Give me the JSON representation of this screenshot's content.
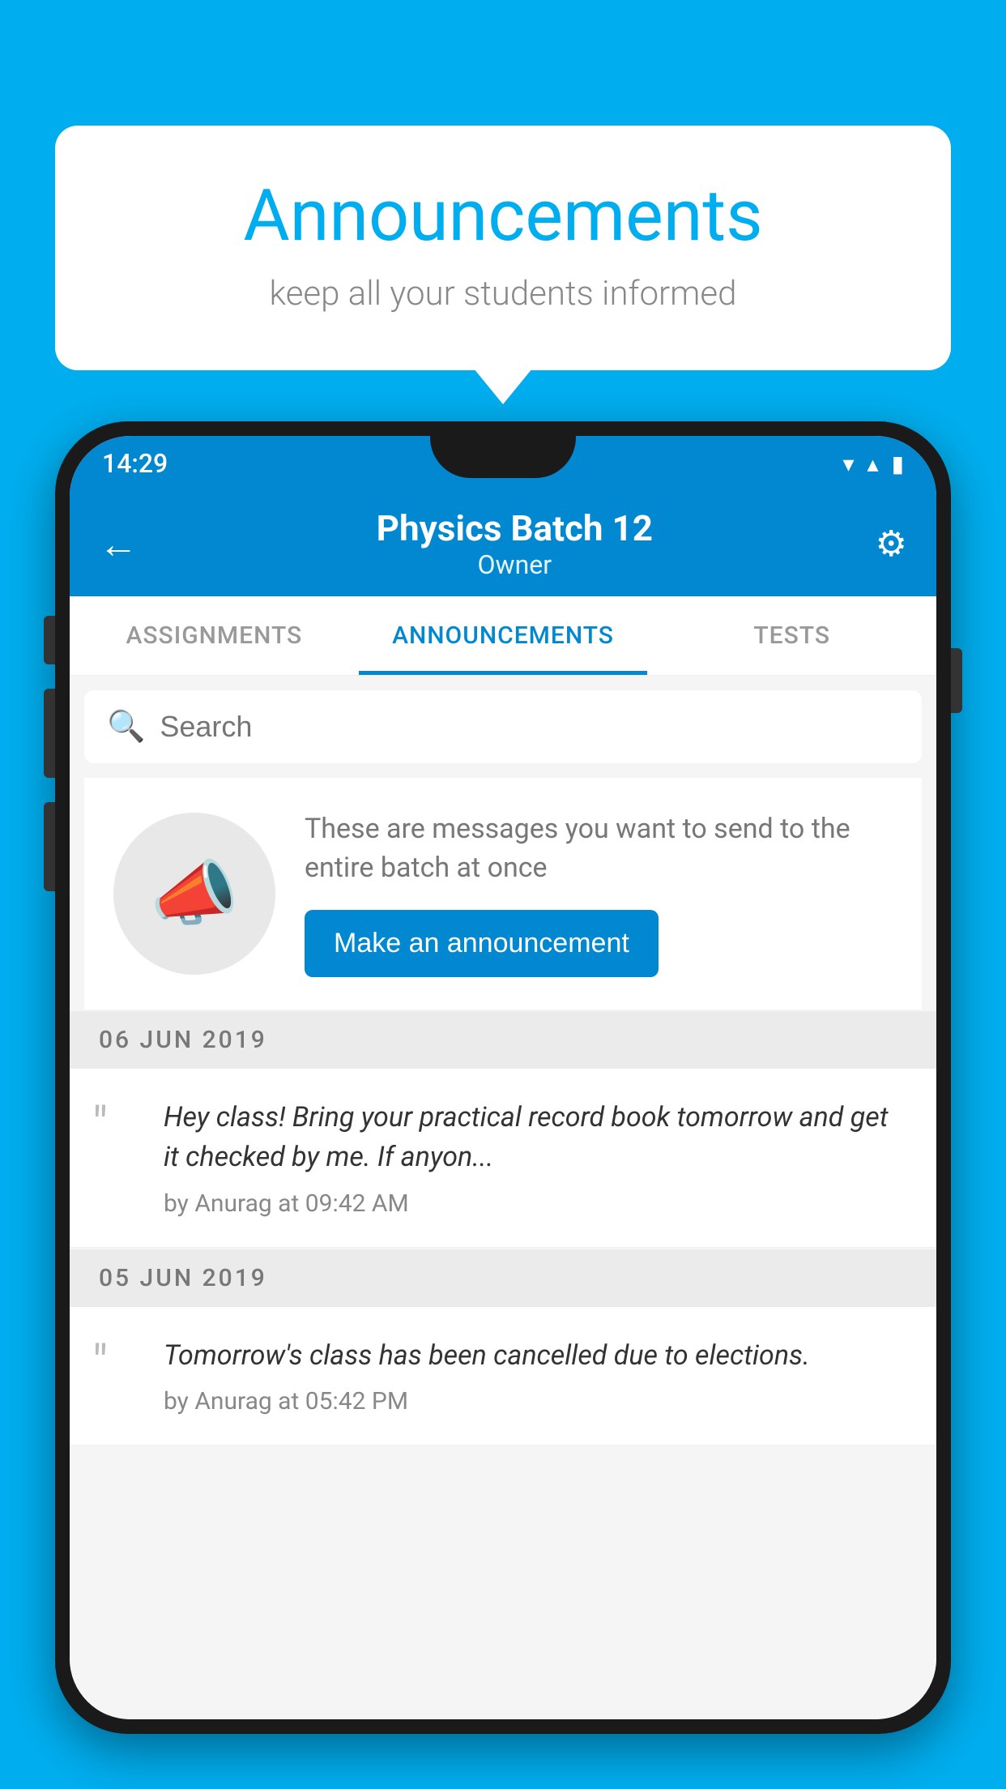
{
  "background_color": "#00AEEF",
  "speech_bubble": {
    "title": "Announcements",
    "subtitle": "keep all your students informed"
  },
  "phone": {
    "status_bar": {
      "time": "14:29",
      "wifi": "▼",
      "signal": "▲",
      "battery": "▮"
    },
    "app_bar": {
      "title": "Physics Batch 12",
      "subtitle": "Owner",
      "back_label": "←",
      "settings_label": "⚙"
    },
    "tabs": [
      {
        "label": "ASSIGNMENTS",
        "active": false
      },
      {
        "label": "ANNOUNCEMENTS",
        "active": true
      },
      {
        "label": "TESTS",
        "active": false
      }
    ],
    "search": {
      "placeholder": "Search"
    },
    "empty_state": {
      "description": "These are messages you want to send to the entire batch at once",
      "button_label": "Make an announcement"
    },
    "announcements": [
      {
        "date": "06  JUN  2019",
        "text": "Hey class! Bring your practical record book tomorrow and get it checked by me. If anyon...",
        "meta": "by Anurag at 09:42 AM"
      },
      {
        "date": "05  JUN  2019",
        "text": "Tomorrow's class has been cancelled due to elections.",
        "meta": "by Anurag at 05:42 PM"
      }
    ]
  }
}
